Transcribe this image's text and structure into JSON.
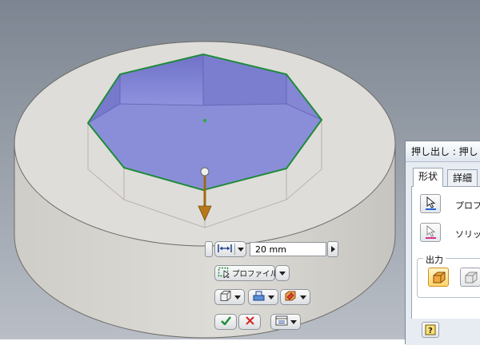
{
  "mini_toolbar": {
    "distance_value": "20 mm",
    "profile_label": "プロファイル"
  },
  "dialog": {
    "title": "押し出し : 押し",
    "tabs": [
      {
        "label": "形状"
      },
      {
        "label": "詳細"
      }
    ],
    "profile_label": "プロファ",
    "solid_label": "ソリッド",
    "output_group_title": "出力"
  },
  "colors": {
    "selection_edge": "#1f8b3a",
    "cavity_floor": "#8b8fd8",
    "part_body": "#dddcd8",
    "background_top": "#7d8692",
    "background_bottom": "#b9bec6",
    "arrow": "#b7781c"
  },
  "icons": {
    "distance": "dimension-arrows-icon",
    "profile": "profile-select-icon",
    "extents": "cube-outline-icon",
    "direction": "flip-direction-icon",
    "operation": "boolean-operation-icon",
    "ok": "checkmark-icon",
    "cancel": "close-icon",
    "options": "panel-options-icon",
    "help": "help-icon"
  }
}
